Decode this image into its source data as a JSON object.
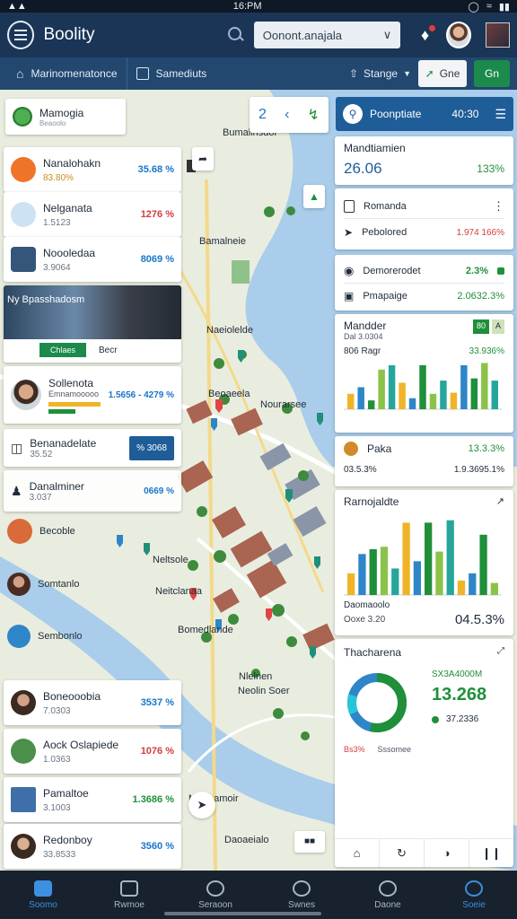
{
  "status_bar": {
    "time": "16:PM"
  },
  "app_bar": {
    "title": "Boolity",
    "dropdown_value": "Oonont.anajala"
  },
  "toolbar": {
    "item1": "Marinomenatonce",
    "item2": "Samediuts",
    "stage_label": "Stange",
    "btn1_label": "Gne",
    "btn2_label": "Gn"
  },
  "map": {
    "layer_card": {
      "title": "Mamogia",
      "subtitle": "Beaoolo"
    },
    "zoom_label": "2",
    "labels": [
      "Bumallnsdor",
      "Bamalneie",
      "Naeiolelde",
      "Beoaeela",
      "Nourarsee",
      "Neltsole",
      "Neitclanaa",
      "Bomedlande",
      "Nlelnen",
      "Neolin Soer",
      "Daoaeialo",
      "Mrmaamoir"
    ]
  },
  "left_cards": [
    {
      "title": "Nanalohakn",
      "sub": "83.80%",
      "value": "35.68 %"
    },
    {
      "title": "Nelganata",
      "sub": "1.5123",
      "value": "1276 %"
    },
    {
      "title": "Noooledaa",
      "sub": "3.9064",
      "value": "8069 %"
    }
  ],
  "media_card": {
    "overlay": "Ny Bpasshadosm",
    "btn": "Chlaes",
    "link": "Becr"
  },
  "profile_card": {
    "title": "Sollenota",
    "sub": "Emnamooooo",
    "value": "1.5656 - 4279 %"
  },
  "list_card": {
    "title": "Benanadelate",
    "sub": "35.52",
    "badge": "% 3068"
  },
  "list_card2": {
    "title": "Danalminer",
    "sub": "3.037",
    "value": "0669 %"
  },
  "floating_labels": [
    "Becoble",
    "Somtanlo",
    "Sembonlo"
  ],
  "bottom_left_cards": [
    {
      "title": "Boneooobia",
      "sub": "7.0303",
      "value": "3537 %"
    },
    {
      "title": "Aock Oslapiede",
      "sub": "1.0363",
      "value": "1076 %"
    },
    {
      "title": "Pamaltoe",
      "sub": "3.1003",
      "value": "1.3686 %"
    },
    {
      "title": "Redonboy",
      "sub": "33.8533",
      "value": "3560 %"
    }
  ],
  "right_header": {
    "label": "Poonptiate",
    "value": "40:30"
  },
  "stats_card": {
    "title": "Mandtiamien",
    "value": "26.06",
    "change": "133%"
  },
  "menu_card": {
    "item1": "Romanda",
    "item2": "Pebolored",
    "item2_value": "1.974 166%"
  },
  "metrics_card": {
    "row1_label": "Demorerodet",
    "row1_value": "2.3%",
    "row2_label": "Pmapaige",
    "row2_value": "2.0632.3%"
  },
  "bar_card1": {
    "title": "Mandder",
    "sub": "Dal 3.0304",
    "legend_label": "806",
    "legend_text": "Ragr",
    "value": "33.936%",
    "badges": [
      "80",
      "A"
    ]
  },
  "pakta_card": {
    "title": "Paka",
    "value": "13.3.3%",
    "sub_label": "03.5.3%",
    "sub_value": "1.9.3695.1%"
  },
  "bar_card2": {
    "title": "Rarnojaldte",
    "footer_label": "Daomaoolo",
    "footer_sub": "Ooxe 3.20",
    "footer_value": "04.5.3%"
  },
  "donut_card": {
    "title": "Thacharena",
    "kpi_label": "SX3A4000M",
    "kpi_value": "13.268",
    "kpi_sub": "37.2336",
    "legend": [
      "Bs3%",
      "Sssomee"
    ]
  },
  "chart_data": [
    {
      "type": "bar",
      "title": "Mandder",
      "values": [
        14,
        20,
        8,
        36,
        40,
        24,
        10,
        40,
        14,
        26,
        15,
        40,
        28,
        42,
        26
      ]
    },
    {
      "type": "bar",
      "title": "Rarnojaldte",
      "values": [
        18,
        34,
        38,
        40,
        22,
        60,
        28,
        60,
        36,
        62,
        12,
        18,
        50,
        10
      ]
    }
  ],
  "bottom_nav": [
    {
      "label": "Soomo",
      "active": true
    },
    {
      "label": "Rwmoe",
      "active": false
    },
    {
      "label": "Seraoon",
      "active": false
    },
    {
      "label": "Swnes",
      "active": false
    },
    {
      "label": "Daone",
      "active": false
    },
    {
      "label": "Soeie",
      "active": false
    }
  ]
}
